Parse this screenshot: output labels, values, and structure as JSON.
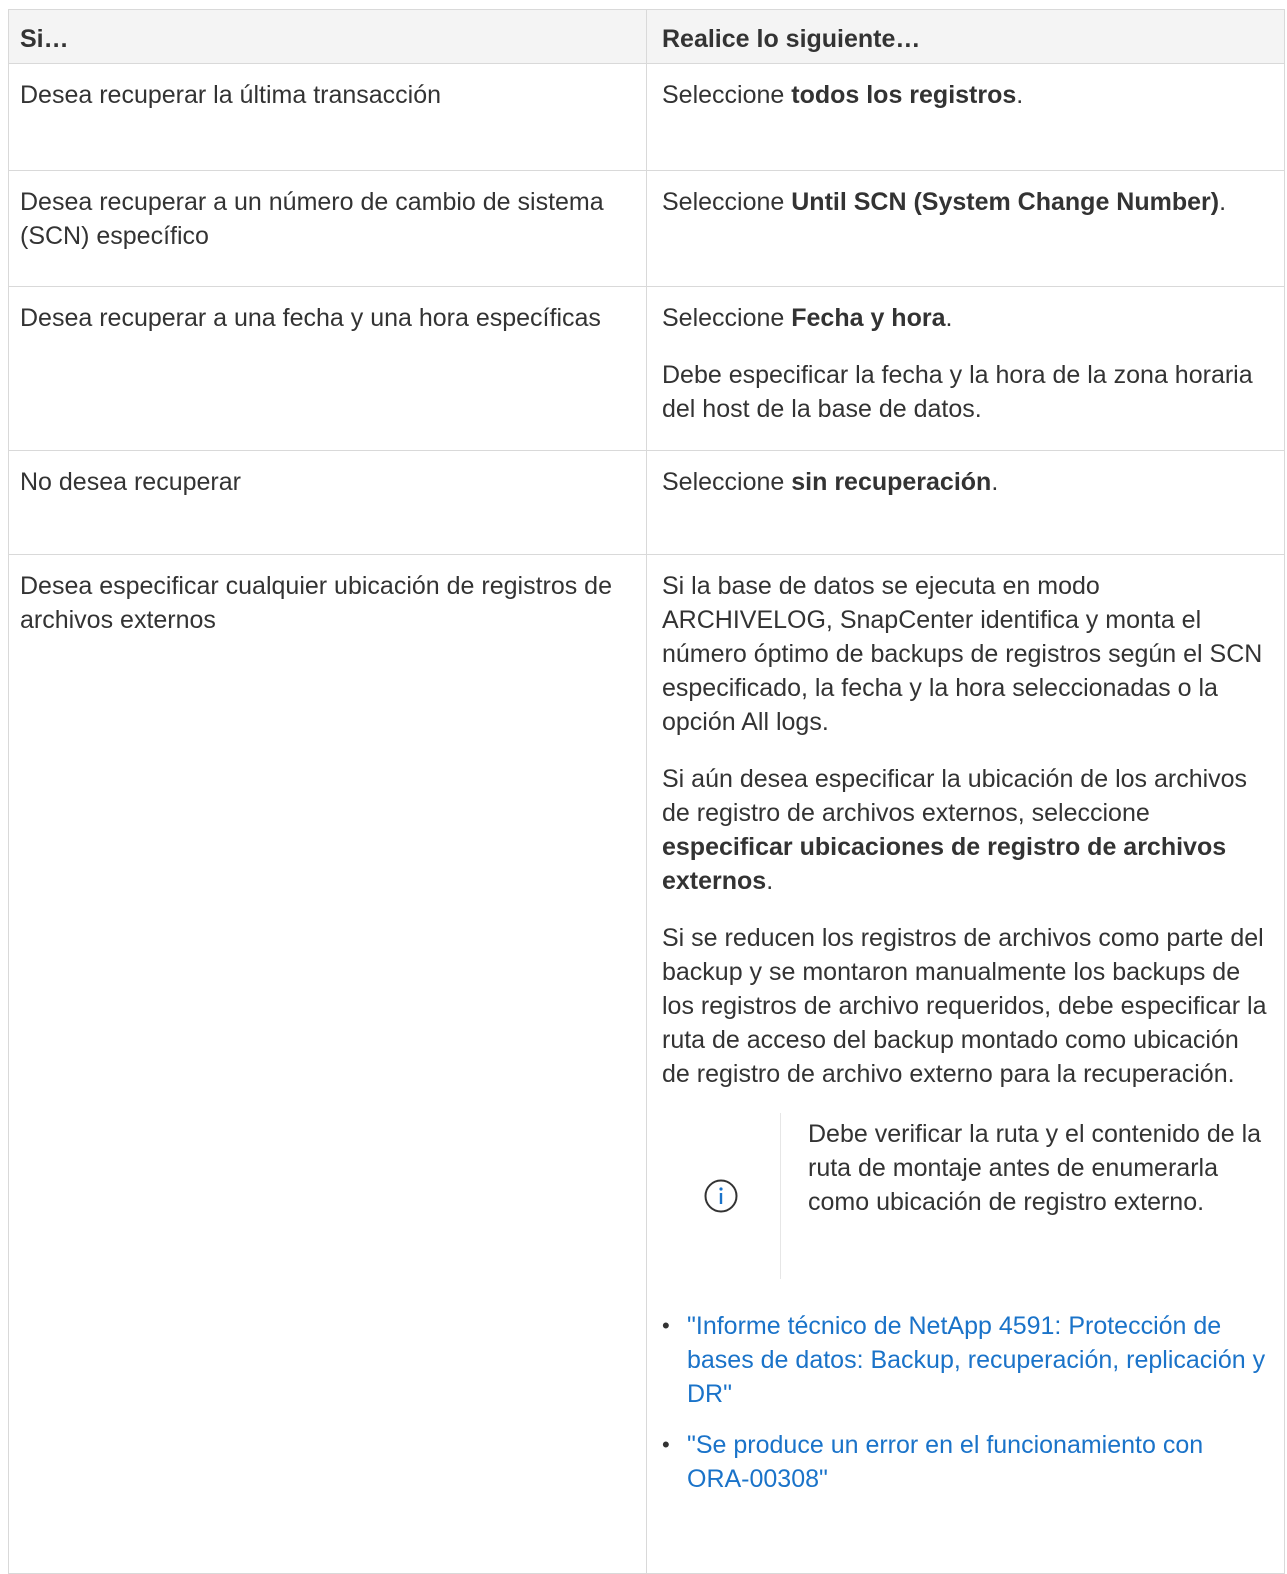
{
  "table": {
    "headers": [
      "Si…",
      "Realice lo siguiente…"
    ],
    "rows": [
      {
        "condition": "Desea recuperar la última transacción",
        "action_prefix": "Seleccione ",
        "action_bold": "todos los registros",
        "action_suffix": "."
      },
      {
        "condition": "Desea recuperar a un número de cambio de sistema (SCN) específico",
        "action_prefix": "Seleccione ",
        "action_bold": "Until SCN (System Change Number)",
        "action_suffix": "."
      },
      {
        "condition": "Desea recuperar a una fecha y una hora específicas",
        "action_prefix": "Seleccione ",
        "action_bold": "Fecha y hora",
        "action_suffix": ".",
        "extra": "Debe especificar la fecha y la hora de la zona horaria del host de la base de datos."
      },
      {
        "condition": "No desea recuperar",
        "action_prefix": "Seleccione ",
        "action_bold": "sin recuperación",
        "action_suffix": "."
      },
      {
        "condition": "Desea especificar cualquier ubicación de registros de archivos externos",
        "para1": "Si la base de datos se ejecuta en modo ARCHIVELOG, SnapCenter identifica y monta el número óptimo de backups de registros según el SCN especificado, la fecha y la hora seleccionadas o la opción All logs.",
        "para2_prefix": "Si aún desea especificar la ubicación de los archivos de registro de archivos externos, seleccione ",
        "para2_bold": "especificar ubicaciones de registro de archivos externos",
        "para2_suffix": ".",
        "para3": "Si se reducen los registros de archivos como parte del backup y se montaron manualmente los backups de los registros de archivo requeridos, debe especificar la ruta de acceso del backup montado como ubicación de registro de archivo externo para la recuperación.",
        "note": {
          "icon": "info-circle-icon",
          "text": "Debe verificar la ruta y el contenido de la ruta de montaje antes de enumerarla como ubicación de registro externo."
        },
        "links": [
          "\"Informe técnico de NetApp 4591: Protección de bases de datos: Backup, recuperación, replicación y DR\"",
          "\"Se produce un error en el funcionamiento con ORA-00308\""
        ]
      }
    ]
  },
  "colors": {
    "text": "#333333",
    "link": "#1a73c9",
    "header_bg": "#f4f4f4",
    "border": "#d9d9d9"
  }
}
